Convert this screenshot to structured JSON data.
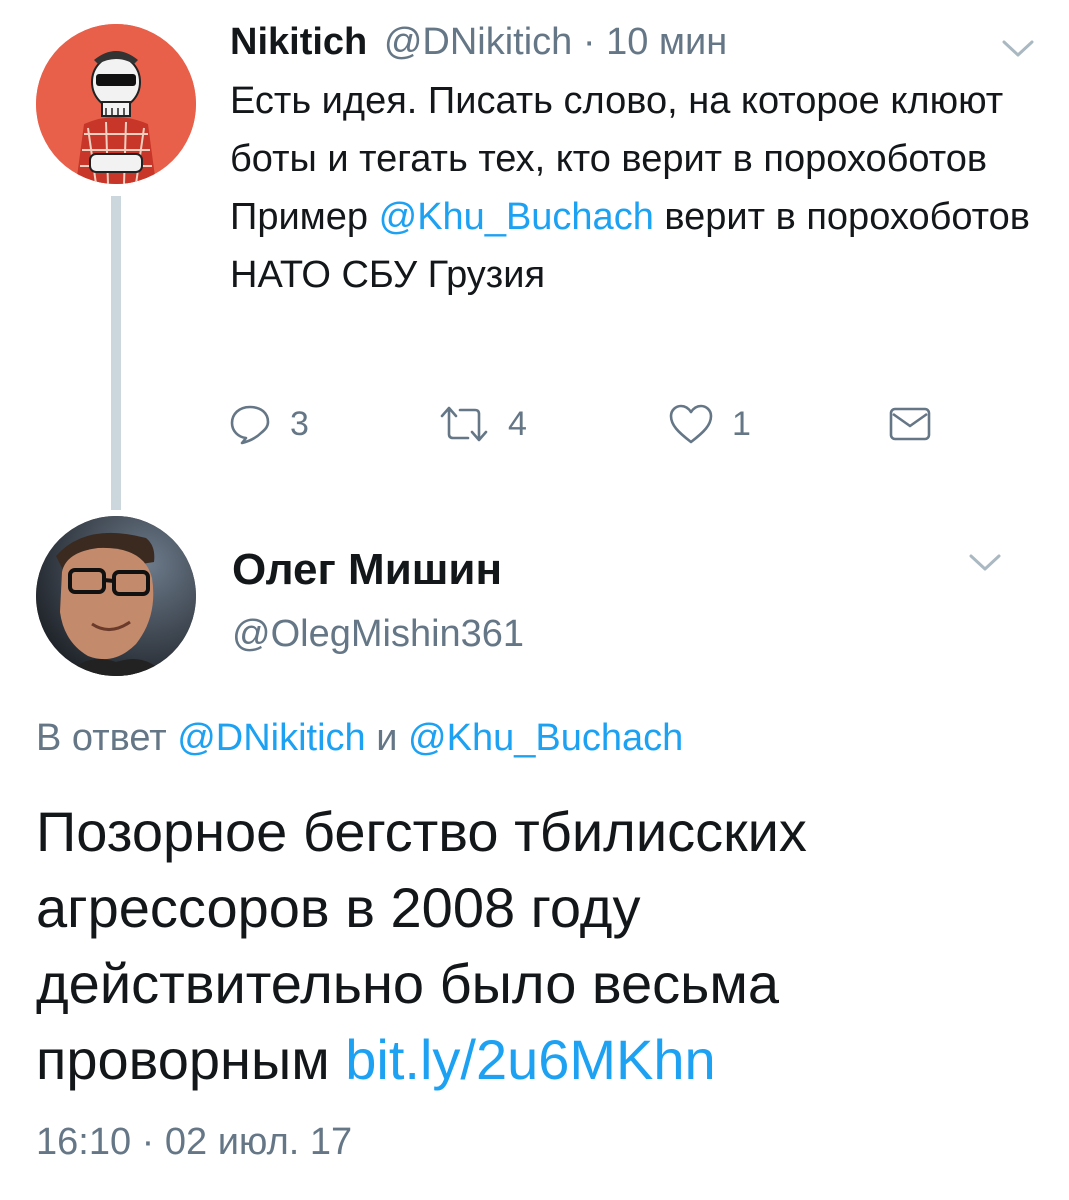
{
  "parent_tweet": {
    "name": "Nikitich",
    "handle": "@DNikitich",
    "separator": " · ",
    "time": "10 мин",
    "text_lines": [
      "Есть идея. Писать слово, на которое клюют боты и тегать тех, кто верит в порохоботов"
    ],
    "example": {
      "prefix": "Пример ",
      "mention": "@Khu_Buchach",
      "suffix": " верит в порохоботов НАТО СБУ Грузия"
    },
    "actions": {
      "reply_count": "3",
      "retweet_count": "4",
      "like_count": "1"
    },
    "avatar_icon": "skull-avatar"
  },
  "main_tweet": {
    "name": "Олег Мишин",
    "handle": "@OlegMishin361",
    "reply_to": {
      "prefix": "В ответ ",
      "mention1": "@DNikitich",
      "joiner": " и ",
      "mention2": "@Khu_Buchach"
    },
    "text": "Позорное бегство тбилисских агрессоров в 2008 году действительно было весьма проворным ",
    "link": "bit.ly/2u6MKhn",
    "timestamp": "16:10 · 02 июл. 17",
    "avatar_icon": "user-photo-avatar"
  },
  "colors": {
    "link": "#1da1f2",
    "muted": "#657786",
    "text": "#14171a",
    "thread_line": "#ccd6dd",
    "parent_avatar_bg": "#e8604a"
  }
}
